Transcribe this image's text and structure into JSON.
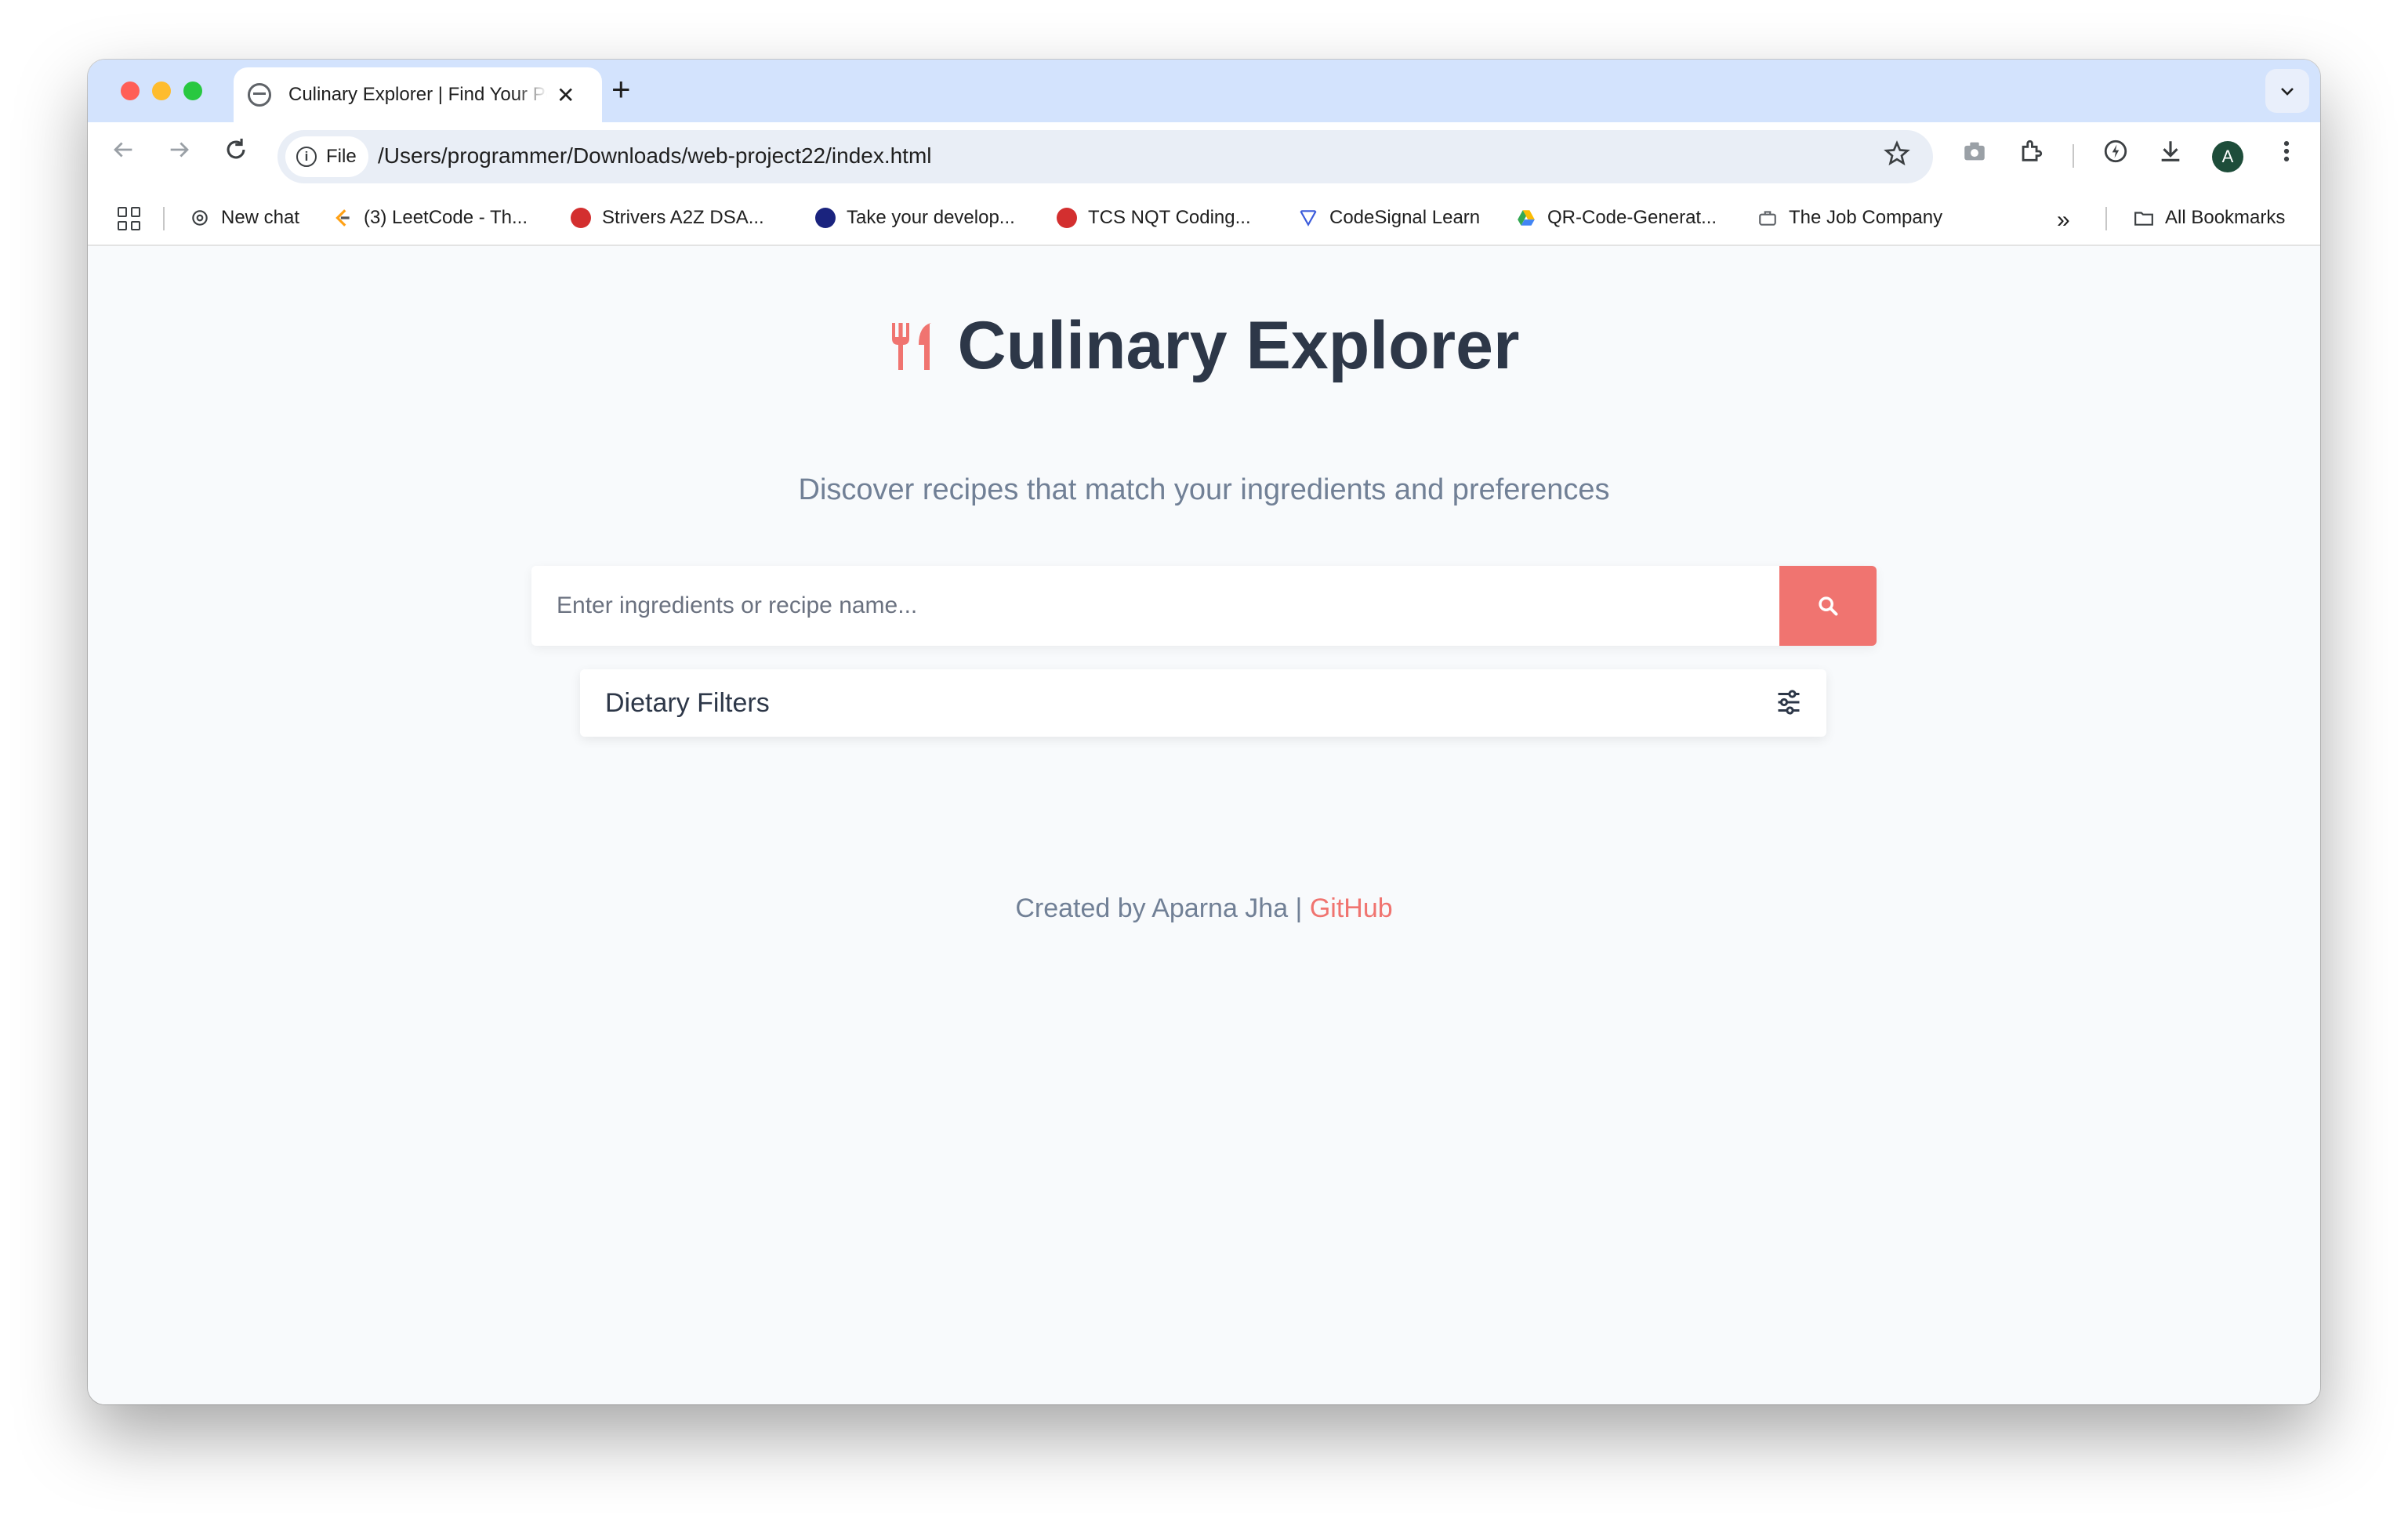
{
  "browser": {
    "tab_title": "Culinary Explorer | Find Your Perfect Recipe",
    "tab_close": "✕",
    "new_tab": "+",
    "url_chip": "File",
    "url": "/Users/programmer/Downloads/web-project22/index.html",
    "avatar_letter": "A",
    "bookmarks": [
      {
        "label": "New chat",
        "icon": "openai-icon",
        "color": "#ffffff"
      },
      {
        "label": "(3) LeetCode - Th...",
        "icon": "leetcode-icon",
        "color": "#ffa116"
      },
      {
        "label": "Strivers A2Z DSA...",
        "icon": "tuf-icon",
        "color": "#d32f2f"
      },
      {
        "label": "Take your develop...",
        "icon": "profile-icon",
        "color": "#1a237e"
      },
      {
        "label": "TCS NQT Coding...",
        "icon": "tuf-icon",
        "color": "#d32f2f"
      },
      {
        "label": "CodeSignal Learn",
        "icon": "codesignal-icon",
        "color": "#3b5bdb"
      },
      {
        "label": "QR-Code-Generat...",
        "icon": "google-drive-icon",
        "color": "#34a853"
      },
      {
        "label": "The Job Company",
        "icon": "briefcase-icon",
        "color": "#5f6368"
      }
    ],
    "all_bookmarks": "All Bookmarks"
  },
  "page": {
    "title": "Culinary Explorer",
    "subtitle": "Discover recipes that match your ingredients and preferences",
    "search_placeholder": "Enter ingredients or recipe name...",
    "search_value": "",
    "filters_label": "Dietary Filters",
    "footer_text": "Created by Aparna Jha | ",
    "footer_link": "GitHub",
    "accent_color": "#f07470",
    "heading_color": "#2d3748"
  }
}
